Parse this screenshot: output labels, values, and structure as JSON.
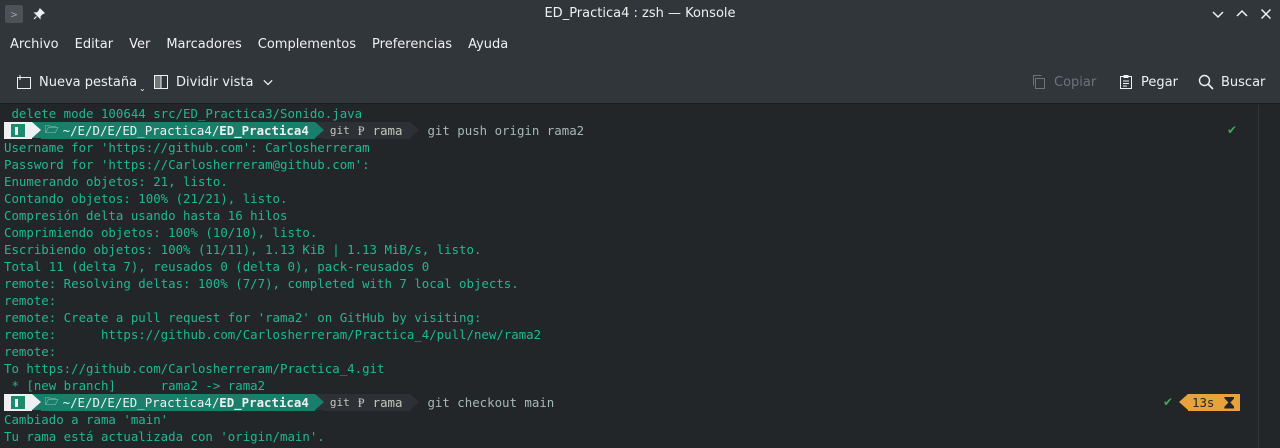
{
  "window": {
    "title": "ED_Practica4 : zsh — Konsole",
    "app_icon": "konsole-icon",
    "pin_icon": "pin-icon"
  },
  "menu": [
    "Archivo",
    "Editar",
    "Ver",
    "Marcadores",
    "Complementos",
    "Preferencias",
    "Ayuda"
  ],
  "toolbar": {
    "new_tab": "Nueva pestaña",
    "split_view": "Dividir vista",
    "copy": "Copiar",
    "paste": "Pegar",
    "search": "Buscar"
  },
  "terminal": {
    "top_line": " delete mode 100644 src/ED_Practica3/Sonido.java",
    "prompt1": {
      "dir_prefix": "~/E/D/E/ED_Practica4/",
      "dir_bold": "ED_Practica4",
      "git": "git",
      "branch": "rama",
      "command": "git push origin rama2",
      "status": "✔"
    },
    "output1": [
      "Username for 'https://github.com': Carlosherreram",
      "Password for 'https://Carlosherreram@github.com':",
      "Enumerando objetos: 21, listo.",
      "Contando objetos: 100% (21/21), listo.",
      "Compresión delta usando hasta 16 hilos",
      "Comprimiendo objetos: 100% (10/10), listo.",
      "Escribiendo objetos: 100% (11/11), 1.13 KiB | 1.13 MiB/s, listo.",
      "Total 11 (delta 7), reusados 0 (delta 0), pack-reusados 0",
      "remote: Resolving deltas: 100% (7/7), completed with 7 local objects.",
      "remote:",
      "remote: Create a pull request for 'rama2' on GitHub by visiting:",
      "remote:      https://github.com/Carlosherreram/Practica_4/pull/new/rama2",
      "remote:",
      "To https://github.com/Carlosherreram/Practica_4.git",
      " * [new branch]      rama2 -> rama2"
    ],
    "prompt2": {
      "dir_prefix": "~/E/D/E/ED_Practica4/",
      "dir_bold": "ED_Practica4",
      "git": "git",
      "branch": "rama",
      "command": "git checkout main",
      "status": "✔",
      "duration": "13s"
    },
    "output2": [
      "Cambiado a rama 'main'",
      "Tu rama está actualizada con 'origin/main'."
    ]
  }
}
